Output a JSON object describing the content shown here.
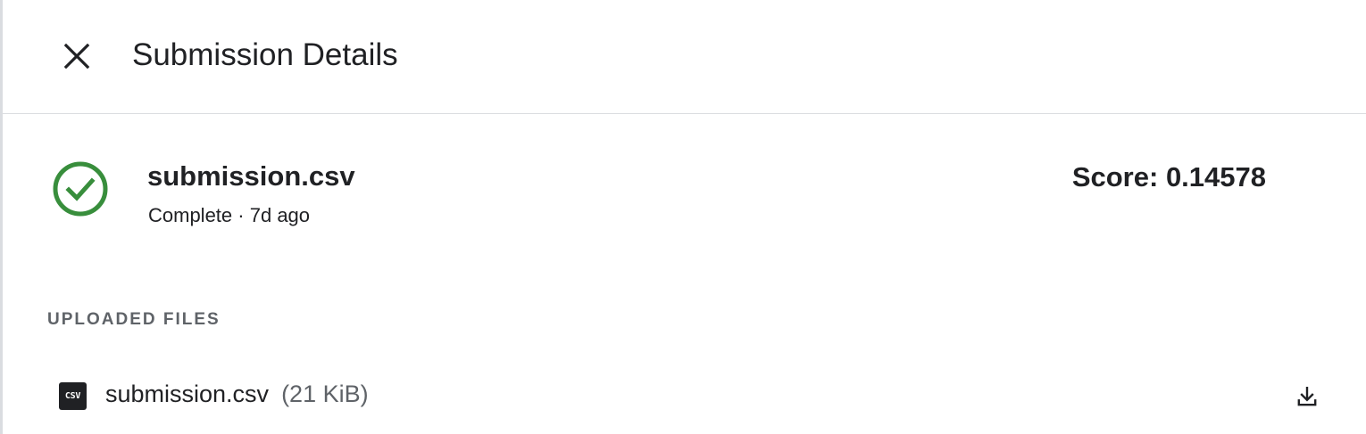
{
  "header": {
    "title": "Submission Details",
    "close_icon": "close-icon"
  },
  "submission": {
    "file_name": "submission.csv",
    "status": "Complete",
    "separator": "·",
    "age": "7d ago",
    "status_icon": "check-circle-icon",
    "status_color": "#388e3c",
    "score_label": "Score:",
    "score_value": "0.14578"
  },
  "uploaded_files": {
    "section_label": "UPLOADED FILES",
    "files": [
      {
        "icon": "csv-file-icon",
        "icon_text": "CSV",
        "name": "submission.csv",
        "size": "(21 KiB)",
        "action_icon": "download-icon"
      }
    ]
  },
  "colors": {
    "text_primary": "#202124",
    "text_secondary": "#5f6368",
    "divider": "#dadce0",
    "success": "#388e3c"
  }
}
